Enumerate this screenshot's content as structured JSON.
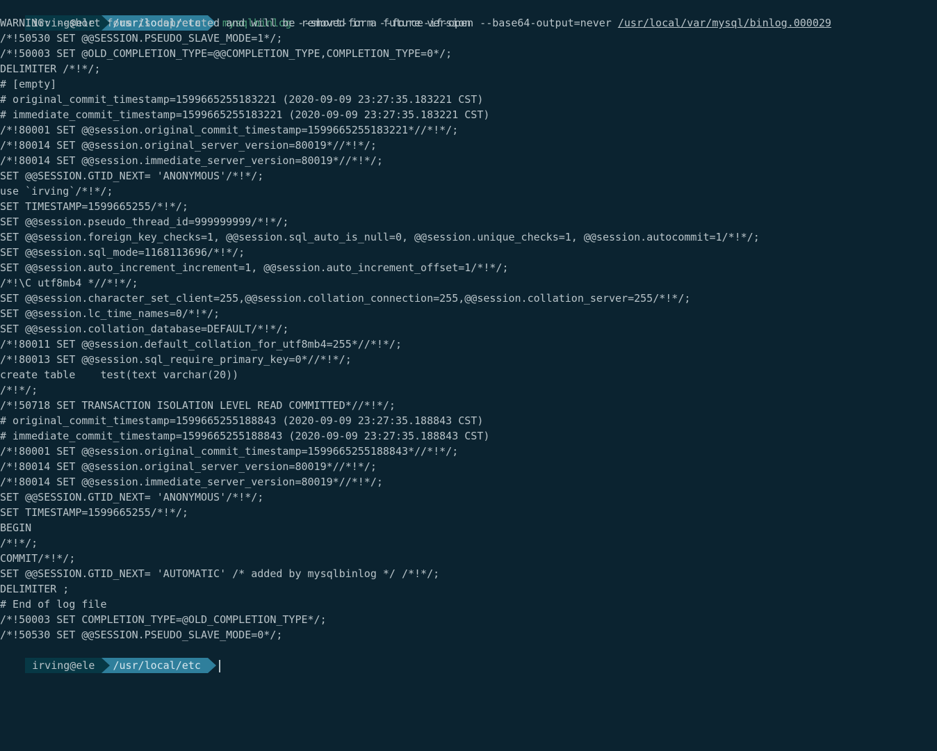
{
  "prompt1": {
    "user_host": "irving@ele",
    "path": "/usr/local/etc",
    "cmd_name": "mysqlbinlog",
    "cmd_args": " --short-form --force-if-open --base64-output=never ",
    "cmd_file": "/usr/local/var/mysql/binlog.000029"
  },
  "output": [
    "WARNING: --short-form is deprecated and will be removed in a future version",
    "",
    "/*!50530 SET @@SESSION.PSEUDO_SLAVE_MODE=1*/;",
    "/*!50003 SET @OLD_COMPLETION_TYPE=@@COMPLETION_TYPE,COMPLETION_TYPE=0*/;",
    "DELIMITER /*!*/;",
    "# [empty]",
    "# original_commit_timestamp=1599665255183221 (2020-09-09 23:27:35.183221 CST)",
    "# immediate_commit_timestamp=1599665255183221 (2020-09-09 23:27:35.183221 CST)",
    "/*!80001 SET @@session.original_commit_timestamp=1599665255183221*//*!*/;",
    "/*!80014 SET @@session.original_server_version=80019*//*!*/;",
    "/*!80014 SET @@session.immediate_server_version=80019*//*!*/;",
    "SET @@SESSION.GTID_NEXT= 'ANONYMOUS'/*!*/;",
    "use `irving`/*!*/;",
    "SET TIMESTAMP=1599665255/*!*/;",
    "SET @@session.pseudo_thread_id=999999999/*!*/;",
    "SET @@session.foreign_key_checks=1, @@session.sql_auto_is_null=0, @@session.unique_checks=1, @@session.autocommit=1/*!*/;",
    "SET @@session.sql_mode=1168113696/*!*/;",
    "SET @@session.auto_increment_increment=1, @@session.auto_increment_offset=1/*!*/;",
    "/*!\\C utf8mb4 *//*!*/;",
    "SET @@session.character_set_client=255,@@session.collation_connection=255,@@session.collation_server=255/*!*/;",
    "SET @@session.lc_time_names=0/*!*/;",
    "SET @@session.collation_database=DEFAULT/*!*/;",
    "/*!80011 SET @@session.default_collation_for_utf8mb4=255*//*!*/;",
    "/*!80013 SET @@session.sql_require_primary_key=0*//*!*/;",
    "create table    test(text varchar(20))",
    "/*!*/;",
    "/*!50718 SET TRANSACTION ISOLATION LEVEL READ COMMITTED*//*!*/;",
    "# original_commit_timestamp=1599665255188843 (2020-09-09 23:27:35.188843 CST)",
    "# immediate_commit_timestamp=1599665255188843 (2020-09-09 23:27:35.188843 CST)",
    "/*!80001 SET @@session.original_commit_timestamp=1599665255188843*//*!*/;",
    "/*!80014 SET @@session.original_server_version=80019*//*!*/;",
    "/*!80014 SET @@session.immediate_server_version=80019*//*!*/;",
    "SET @@SESSION.GTID_NEXT= 'ANONYMOUS'/*!*/;",
    "SET TIMESTAMP=1599665255/*!*/;",
    "BEGIN",
    "/*!*/;",
    "COMMIT/*!*/;",
    "SET @@SESSION.GTID_NEXT= 'AUTOMATIC' /* added by mysqlbinlog */ /*!*/;",
    "DELIMITER ;",
    "# End of log file",
    "/*!50003 SET COMPLETION_TYPE=@OLD_COMPLETION_TYPE*/;",
    "/*!50530 SET @@SESSION.PSEUDO_SLAVE_MODE=0*/;"
  ],
  "prompt2": {
    "user_host": "irving@ele",
    "path": "/usr/local/etc"
  }
}
